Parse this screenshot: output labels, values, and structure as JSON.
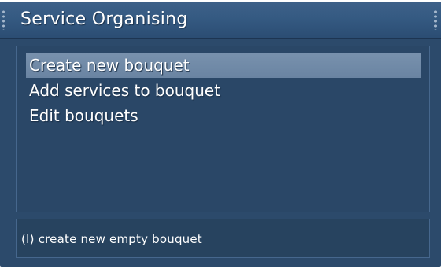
{
  "window": {
    "title": "Service Organising"
  },
  "menu": {
    "items": [
      {
        "label": "Create new bouquet",
        "selected": true
      },
      {
        "label": "Add services to bouquet",
        "selected": false
      },
      {
        "label": "Edit bouquets",
        "selected": false
      }
    ]
  },
  "help": {
    "text": "(I) create new empty bouquet"
  },
  "colors": {
    "background": "#2c4a6b",
    "titlebar": "#3e6189",
    "selection": "#7891ad",
    "text": "#ffffff"
  }
}
